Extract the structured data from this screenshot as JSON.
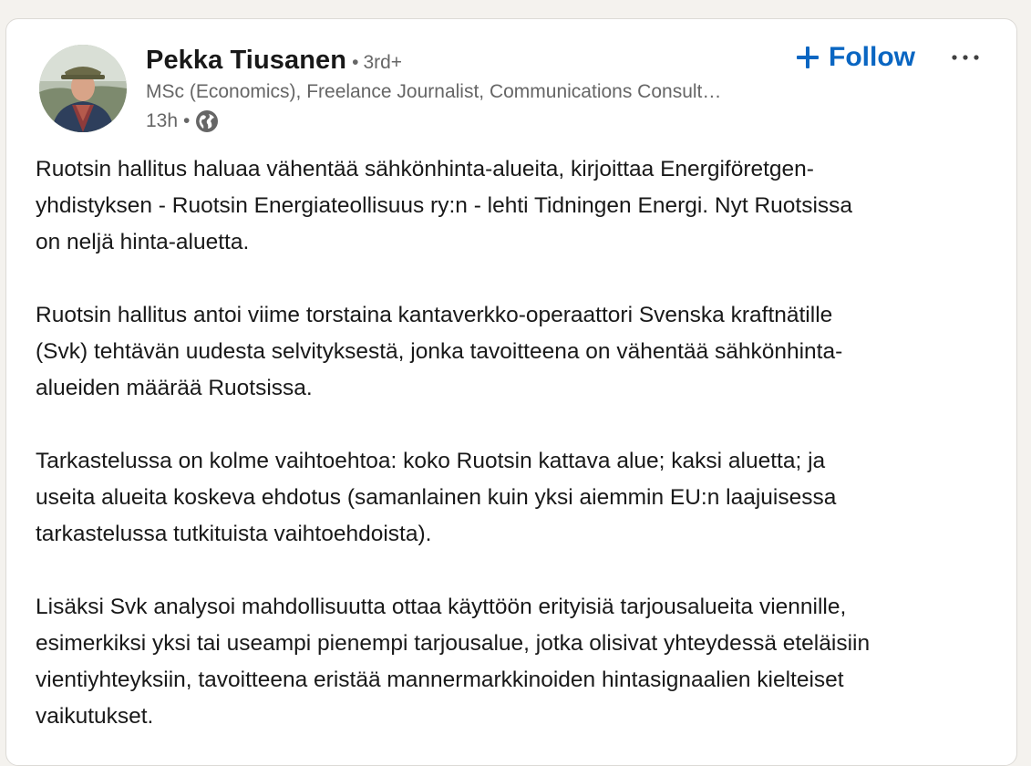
{
  "post": {
    "author": {
      "name": "Pekka Tiusanen",
      "degree": "3rd+",
      "headline": "MSc (Economics), Freelance Journalist, Communications Consult…",
      "time": "13h",
      "visibility_icon": "globe-icon"
    },
    "actions": {
      "follow_label": "Follow",
      "follow_icon": "plus-icon",
      "more_icon": "ellipsis-icon"
    },
    "paragraphs": [
      {
        "lines": [
          "Ruotsin hallitus haluaa vähentää sähkönhinta-alueita, kirjoittaa Energiföretgen-",
          "yhdistyksen - Ruotsin Energiateollisuus ry:n - lehti Tidningen Energi. Nyt Ruotsissa",
          "on neljä hinta-aluetta."
        ]
      },
      {
        "lines": [
          "Ruotsin hallitus antoi viime torstaina kantaverkko-operaattori Svenska kraftnätille",
          "(Svk) tehtävän uudesta selvityksestä, jonka tavoitteena on vähentää sähkönhinta-",
          "alueiden määrää Ruotsissa."
        ]
      },
      {
        "lines": [
          "Tarkastelussa on kolme vaihtoehtoa: koko Ruotsin kattava alue; kaksi aluetta; ja",
          "useita alueita koskeva ehdotus (samanlainen kuin yksi aiemmin EU:n laajuisessa",
          "tarkastelussa tutkituista vaihtoehdoista)."
        ]
      },
      {
        "lines": [
          "Lisäksi Svk analysoi mahdollisuutta ottaa käyttöön erityisiä tarjousalueita viennille,",
          "esimerkiksi yksi tai useampi pienempi tarjousalue, jotka olisivat yhteydessä eteläisiin",
          "vientiyhteyksiin, tavoitteena eristää mannermarkkinoiden hintasignaalien kielteiset",
          "vaikutukset."
        ]
      }
    ]
  },
  "colors": {
    "accent": "#0a66c2",
    "text_primary": "#191919",
    "text_secondary": "#666666",
    "card_background": "#ffffff",
    "page_background": "#f4f2ee"
  }
}
